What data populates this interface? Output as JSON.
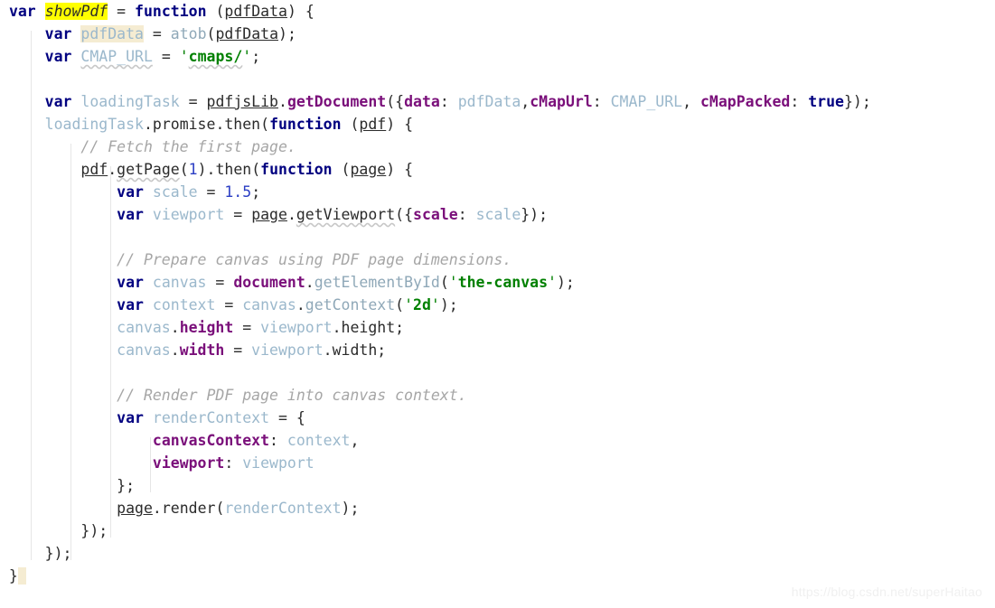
{
  "editor": {
    "background": "#ffffff",
    "font_size_px": 16.5,
    "line_height_px": 25,
    "language": "JavaScript"
  },
  "colors": {
    "keyword": "#000080",
    "identifier": "#9bb8cc",
    "string": "#008000",
    "number": "#2b3ec4",
    "method": "#7a0f7a",
    "property": "#7a0f7a",
    "comment": "#a6a6a6",
    "punctuation": "#2b2b2b",
    "search_highlight": "#ffff00",
    "usage_highlight": "#f5ecd2",
    "indent_guide": "#e6e6e6",
    "watermark": "#f0f0f0"
  },
  "highlights": {
    "function_name": "showPdf",
    "usage_symbol": "pdfData"
  },
  "watermark": {
    "text": "https://blog.csdn.net/superHaitao"
  },
  "code": {
    "lines": [
      "var showPdf = function (pdfData) {",
      "    var pdfData = atob(pdfData);",
      "    var CMAP_URL = 'cmaps/';",
      "",
      "    var loadingTask = pdfjsLib.getDocument({data: pdfData,cMapUrl: CMAP_URL, cMapPacked: true});",
      "    loadingTask.promise.then(function (pdf) {",
      "        // Fetch the first page.",
      "        pdf.getPage(1).then(function (page) {",
      "            var scale = 1.5;",
      "            var viewport = page.getViewport({scale: scale});",
      "",
      "            // Prepare canvas using PDF page dimensions.",
      "            var canvas = document.getElementById('the-canvas');",
      "            var context = canvas.getContext('2d');",
      "            canvas.height = viewport.height;",
      "            canvas.width = viewport.width;",
      "",
      "            // Render PDF page into canvas context.",
      "            var renderContext = {",
      "                canvasContext: context,",
      "                viewport: viewport",
      "            };",
      "            page.render(renderContext);",
      "        });",
      "    });",
      "}"
    ],
    "tokens": {
      "var": "var",
      "function": "function",
      "true": "true",
      "showPdf": "showPdf",
      "pdfData": "pdfData",
      "atob": "atob",
      "CMAP_URL": "CMAP_URL",
      "cmaps_str": "cmaps/",
      "loadingTask": "loadingTask",
      "pdfjsLib": "pdfjsLib",
      "getDocument": "getDocument",
      "data_key": "data",
      "cMapUrl_key": "cMapUrl",
      "cMapPacked_key": "cMapPacked",
      "promise": "promise",
      "then": "then",
      "pdf": "pdf",
      "comment_fetch": "// Fetch the first page.",
      "getPage": "getPage",
      "one": "1",
      "page": "page",
      "scale": "scale",
      "scale_value": "1.5",
      "viewport": "viewport",
      "getViewport": "getViewport",
      "comment_prepare": "// Prepare canvas using PDF page dimensions.",
      "canvas": "canvas",
      "document": "document",
      "getElementById": "getElementById",
      "the_canvas_str": "the-canvas",
      "context": "context",
      "getContext": "getContext",
      "twod_str": "2d",
      "height": "height",
      "width": "width",
      "comment_render": "// Render PDF page into canvas context.",
      "renderContext": "renderContext",
      "canvasContext_key": "canvasContext",
      "viewport_key": "viewport",
      "render": "render"
    }
  }
}
